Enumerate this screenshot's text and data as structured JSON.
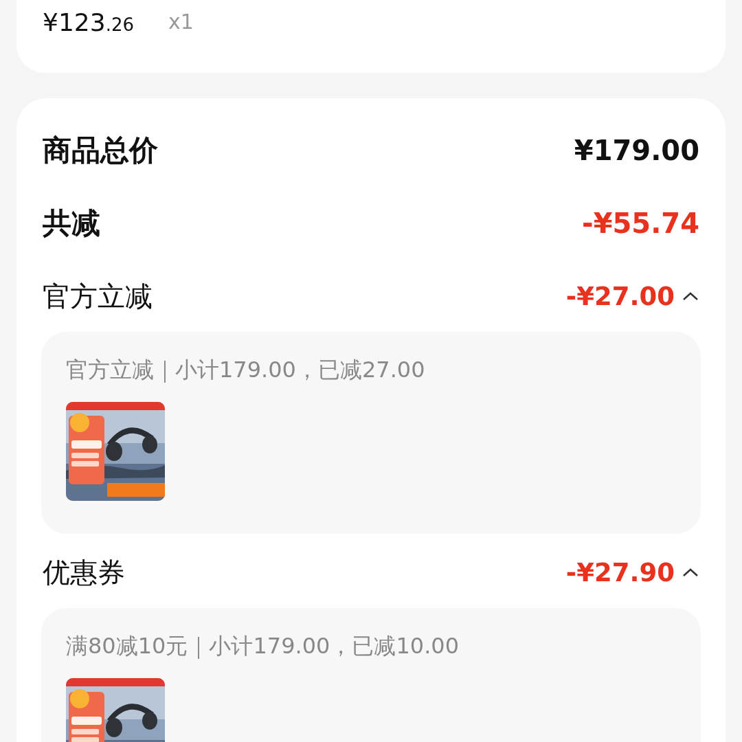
{
  "order_item": {
    "price_main": "¥123",
    "price_cents": ".26",
    "quantity": "x1"
  },
  "summary": {
    "rows": [
      {
        "kind": "total",
        "label": "商品总价",
        "amount": "¥179.00"
      },
      {
        "kind": "discount_total",
        "label": "共减",
        "amount": "-¥55.74"
      },
      {
        "kind": "discount",
        "label": "官方立减",
        "amount": "-¥27.00",
        "expanded": true,
        "detail": {
          "text": "官方立减｜小计179.00，已减27.00"
        }
      },
      {
        "kind": "discount",
        "label": "优惠券",
        "amount": "-¥27.90",
        "expanded": true,
        "detail": {
          "text": "满80减10元｜小计179.00，已减10.00"
        }
      }
    ]
  }
}
